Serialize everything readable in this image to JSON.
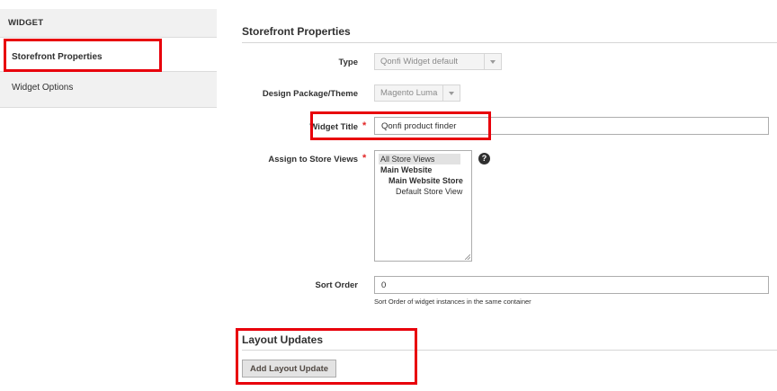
{
  "sidebar": {
    "header": "WIDGET",
    "items": [
      {
        "label": "Storefront Properties"
      },
      {
        "label": "Widget Options"
      }
    ]
  },
  "storefront": {
    "title": "Storefront Properties",
    "type": {
      "label": "Type",
      "value": "Qonfi Widget default"
    },
    "theme": {
      "label": "Design Package/Theme",
      "value": "Magento Luma"
    },
    "widget_title": {
      "label": "Widget Title",
      "value": "Qonfi product finder"
    },
    "store_views": {
      "label": "Assign to Store Views",
      "options": [
        "All Store Views",
        "Main Website",
        "Main Website Store",
        "Default Store View"
      ],
      "help_icon": "?"
    },
    "sort_order": {
      "label": "Sort Order",
      "value": "0",
      "note": "Sort Order of widget instances in the same container"
    },
    "required_mark": "*"
  },
  "layout_updates": {
    "title": "Layout Updates",
    "add_button": "Add Layout Update"
  },
  "colors": {
    "highlight": "#e8000b",
    "required": "#e22626",
    "sidebar_bg": "#f1f1f1"
  }
}
